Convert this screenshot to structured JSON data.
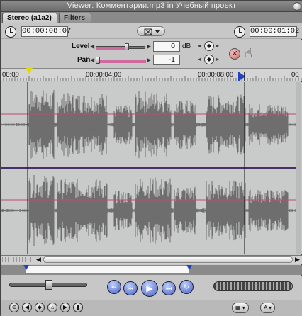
{
  "window": {
    "title": "Viewer: Комментарии.mp3 in Учебный проект"
  },
  "tabs": [
    {
      "label": "Stereo (a1a2)"
    },
    {
      "label": "Filters"
    }
  ],
  "timecode": {
    "duration": "00:00:08:07",
    "current": "00:00:01:02"
  },
  "controls": {
    "level_label": "Level",
    "level_value": "0",
    "level_unit": "dB",
    "pan_label": "Pan",
    "pan_value": "-1"
  },
  "ruler": {
    "labels": [
      "00:00",
      "00:00:04:00",
      "00:00:08:00",
      "00"
    ]
  },
  "icons": {
    "duration_clock": "clock-icon",
    "current_clock": "clock-icon",
    "zoom": "zoom-popup-icon",
    "reset": "reset-x-icon",
    "hand": "drag-hand-icon"
  },
  "colors": {
    "waveform": "#6e6e6e",
    "level_line": "#c0497a",
    "in_out_marker": "#2241c2",
    "playhead": "#e6d700",
    "transport": "#4b5fbf"
  }
}
